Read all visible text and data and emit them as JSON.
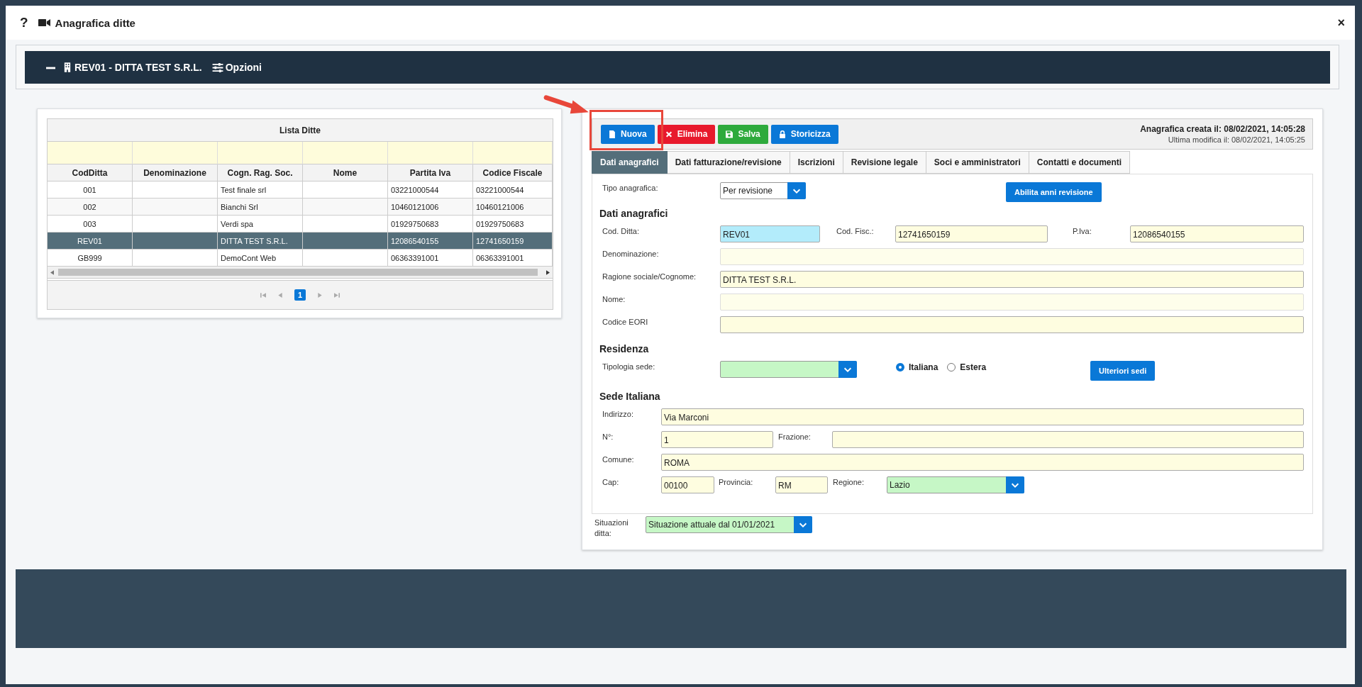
{
  "window": {
    "help": "?",
    "title": "Anagrafica ditte",
    "close": "×"
  },
  "header_bar": {
    "title": "REV01 - DITTA TEST S.R.L.",
    "options": "Opzioni"
  },
  "company_list": {
    "title": "Lista Ditte",
    "columns": [
      "CodDitta",
      "Denominazione",
      "Cogn. Rag. Soc.",
      "Nome",
      "Partita Iva",
      "Codice Fiscale"
    ],
    "rows": [
      {
        "cells": [
          "001",
          "",
          "Test finale srl",
          "",
          "03221000544",
          "03221000544"
        ],
        "selected": false
      },
      {
        "cells": [
          "002",
          "",
          "Bianchi Srl",
          "",
          "10460121006",
          "10460121006"
        ],
        "selected": false
      },
      {
        "cells": [
          "003",
          "",
          "Verdi spa",
          "",
          "01929750683",
          "01929750683"
        ],
        "selected": false
      },
      {
        "cells": [
          "REV01",
          "",
          "DITTA TEST S.R.L.",
          "",
          "12086540155",
          "12741650159"
        ],
        "selected": true
      },
      {
        "cells": [
          "GB999",
          "",
          "DemoCont Web",
          "",
          "06363391001",
          "06363391001"
        ],
        "selected": false
      }
    ],
    "pages": [
      {
        "label": "1",
        "selected": true
      }
    ]
  },
  "toolbar": {
    "buttons": [
      {
        "label": "Nuova",
        "kind": "primary"
      },
      {
        "label": "Elimina",
        "kind": "danger"
      },
      {
        "label": "Salva",
        "kind": "success"
      },
      {
        "label": "Storicizza",
        "kind": "primary"
      }
    ],
    "created": "Anagrafica creata il: 08/02/2021, 14:05:28",
    "modified": "Ultima modifica il: 08/02/2021, 14:05:25"
  },
  "tabs": [
    {
      "label": "Dati anagrafici",
      "selected": true
    },
    {
      "label": "Dati fatturazione/revisione",
      "selected": false
    },
    {
      "label": "Iscrizioni",
      "selected": false
    },
    {
      "label": "Revisione legale",
      "selected": false
    },
    {
      "label": "Soci e amministratori",
      "selected": false
    },
    {
      "label": "Contatti e documenti",
      "selected": false
    }
  ],
  "form": {
    "tipo_anagrafica": {
      "label": "Tipo anagrafica:",
      "value": "Per revisione"
    },
    "enable_button": "Abilita anni revisione",
    "sections": [
      {
        "title": "Dati anagrafici",
        "rows": [
          {
            "kind": "triple",
            "items": [
              {
                "kind": "key",
                "label": "Cod. Ditta:",
                "value": "REV01",
                "disabled": false
              },
              {
                "kind": "text",
                "label": "Cod. Fisc.:",
                "value": "12741650159",
                "disabled": false
              },
              {
                "kind": "text",
                "label": "P.Iva:",
                "value": "12086540155",
                "disabled": false
              }
            ]
          },
          {
            "kind": "single",
            "items": [
              {
                "kind": "text",
                "label": "Denominazione:",
                "disabled": true
              }
            ]
          },
          {
            "kind": "single",
            "items": [
              {
                "kind": "text",
                "label": "Ragione sociale/Cognome:",
                "value": "DITTA TEST S.R.L.",
                "disabled": false
              }
            ]
          },
          {
            "kind": "single",
            "items": [
              {
                "kind": "text",
                "label": "Nome:",
                "disabled": true
              }
            ]
          },
          {
            "kind": "single",
            "items": [
              {
                "kind": "text",
                "label": "Codice EORI",
                "disabled": false
              }
            ]
          }
        ]
      },
      {
        "title": "Residenza",
        "rows": [
          {
            "kind": "residence",
            "items": [
              {
                "kind": "select",
                "label": "Tipologia sede:",
                "disabled": false
              }
            ],
            "radios": [
              {
                "label": "Italiana",
                "selected": true
              },
              {
                "label": "Estera",
                "selected": false
              }
            ],
            "button": "Ulteriori sedi"
          }
        ]
      },
      {
        "title": "Sede Italiana",
        "rows": [
          {
            "kind": "short-single",
            "items": [
              {
                "kind": "text",
                "label": "Indirizzo:",
                "value": "Via Marconi",
                "disabled": false
              }
            ]
          },
          {
            "kind": "pair",
            "items": [
              {
                "kind": "text",
                "label": "N°:",
                "value": "1",
                "disabled": false
              },
              {
                "kind": "text",
                "label": "Frazione:",
                "disabled": false
              }
            ]
          },
          {
            "kind": "short-single",
            "items": [
              {
                "kind": "text",
                "label": "Comune:",
                "value": "ROMA",
                "disabled": false
              }
            ]
          },
          {
            "kind": "quad",
            "items": [
              {
                "kind": "text",
                "label": "Cap:",
                "value": "00100",
                "disabled": false
              },
              {
                "kind": "text",
                "label": "Provincia:",
                "value": "RM",
                "disabled": false
              },
              {
                "kind": "select",
                "label": "Regione:",
                "value": "Lazio",
                "disabled": false
              }
            ]
          }
        ]
      }
    ],
    "situation": {
      "label": "Situazioni ditta:",
      "value": "Situazione attuale dal 01/01/2021"
    }
  }
}
